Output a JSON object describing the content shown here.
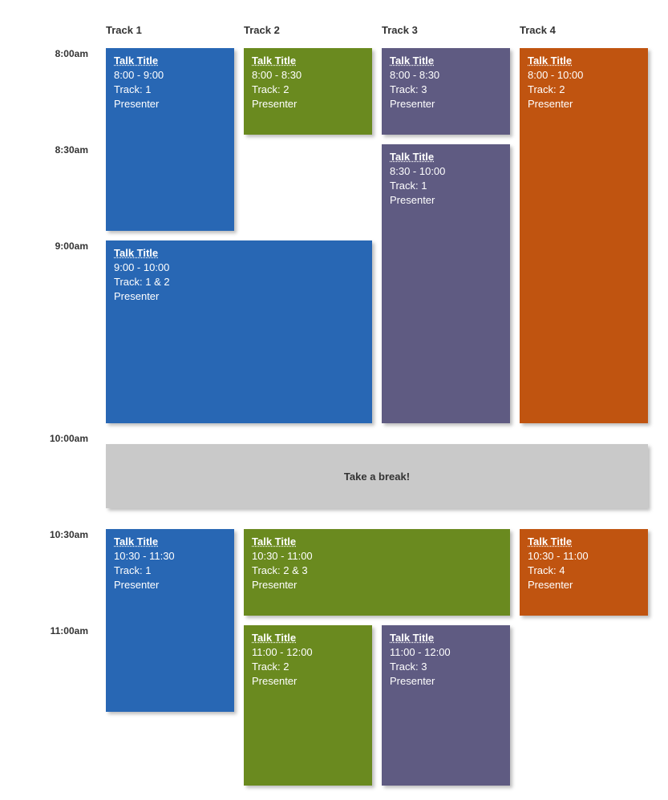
{
  "tracks": [
    "Track 1",
    "Track 2",
    "Track 3",
    "Track 4"
  ],
  "times": [
    "8:00am",
    "8:30am",
    "9:00am",
    "10:00am",
    "10:30am",
    "11:00am"
  ],
  "break_label": "Take a break!",
  "events": [
    {
      "id": "e1",
      "title": "Talk Title",
      "time": "8:00 - 9:00",
      "track": "Track: 1",
      "presenter": "Presenter"
    },
    {
      "id": "e2",
      "title": "Talk Title",
      "time": "8:00 - 8:30",
      "track": "Track: 2",
      "presenter": "Presenter"
    },
    {
      "id": "e3",
      "title": "Talk Title",
      "time": "8:00 - 8:30",
      "track": "Track: 3",
      "presenter": "Presenter"
    },
    {
      "id": "e4",
      "title": "Talk Title",
      "time": "8:00 - 10:00",
      "track": "Track: 2",
      "presenter": "Presenter"
    },
    {
      "id": "e5",
      "title": "Talk Title",
      "time": "8:30 - 10:00",
      "track": "Track: 1",
      "presenter": "Presenter"
    },
    {
      "id": "e6",
      "title": "Talk Title",
      "time": "9:00 - 10:00",
      "track": "Track: 1 & 2",
      "presenter": "Presenter"
    },
    {
      "id": "e7",
      "title": "Talk Title",
      "time": "10:30 - 11:30",
      "track": "Track: 1",
      "presenter": "Presenter"
    },
    {
      "id": "e8",
      "title": "Talk Title",
      "time": "10:30 - 11:00",
      "track": "Track: 2 & 3",
      "presenter": "Presenter"
    },
    {
      "id": "e9",
      "title": "Talk Title",
      "time": "10:30 - 11:00",
      "track": "Track: 4",
      "presenter": "Presenter"
    },
    {
      "id": "e10",
      "title": "Talk Title",
      "time": "11:00 - 12:00",
      "track": "Track: 2",
      "presenter": "Presenter"
    },
    {
      "id": "e11",
      "title": "Talk Title",
      "time": "11:00 - 12:00",
      "track": "Track: 3",
      "presenter": "Presenter"
    }
  ]
}
